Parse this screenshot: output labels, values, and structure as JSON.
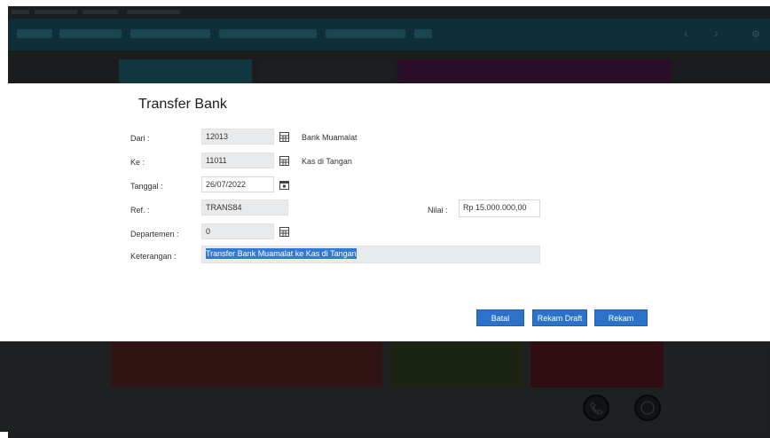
{
  "modal": {
    "title": "Transfer Bank",
    "dari": {
      "label": "Dari :",
      "value": "12013",
      "description": "Bank Muamalat"
    },
    "ke": {
      "label": "Ke :",
      "value": "11011",
      "description": "Kas di Tangan"
    },
    "tanggal": {
      "label": "Tanggal :",
      "value": "26/07/2022"
    },
    "ref": {
      "label": "Ref. :",
      "value": "TRANS84"
    },
    "departemen": {
      "label": "Departemen :",
      "value": "0"
    },
    "keterangan": {
      "label": "Keterangan :",
      "value": "Transfer Bank Muamalat ke Kas di Tangan"
    },
    "nilai": {
      "label": "Nilai :",
      "value": "Rp 15.000.000,00"
    },
    "buttons": {
      "batal": "Batal",
      "rekam_draft": "Rekam Draft",
      "rekam": "Rekam"
    }
  },
  "colors": {
    "accent": "#2b72c9",
    "selection": "#3279d6",
    "field_bg": "#e9eaeb",
    "app_header": "#0e2f3a"
  },
  "icons": {
    "lookup": "grid-lookup-icon",
    "calendar": "calendar-icon",
    "phone": "phone-icon",
    "whatsapp": "whatsapp-icon",
    "nav_prev": "chevron-left-icon",
    "nav_next": "chevron-right-icon",
    "settings": "gear-icon"
  }
}
